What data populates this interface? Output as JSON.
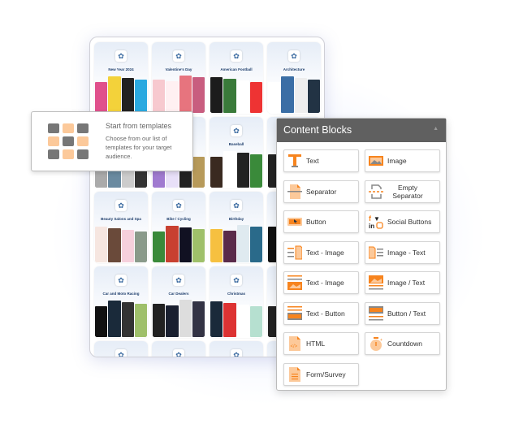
{
  "templates": [
    {
      "title": "New Year 2024"
    },
    {
      "title": "Valentine's Day"
    },
    {
      "title": "American Football"
    },
    {
      "title": "Architecture"
    },
    {
      "title": ""
    },
    {
      "title": ""
    },
    {
      "title": "Baseball"
    },
    {
      "title": ""
    },
    {
      "title": "Beauty Salons and Spa"
    },
    {
      "title": "Bike / Cycling"
    },
    {
      "title": "Birthday"
    },
    {
      "title": ""
    },
    {
      "title": "Car and Moto Racing"
    },
    {
      "title": "Car Dealers"
    },
    {
      "title": "Christmas"
    },
    {
      "title": ""
    },
    {
      "title": ""
    },
    {
      "title": ""
    },
    {
      "title": ""
    },
    {
      "title": ""
    }
  ],
  "tooltip": {
    "title": "Start from templates",
    "description": "Choose from our list of templates for your target audience."
  },
  "content_blocks": {
    "title": "Content Blocks",
    "accent": "#f7841e",
    "items": [
      {
        "label": "Text",
        "icon": "text-icon"
      },
      {
        "label": "Image",
        "icon": "image-icon"
      },
      {
        "label": "Separator",
        "icon": "separator-icon"
      },
      {
        "label": "Empty Separator",
        "icon": "empty-separator-icon"
      },
      {
        "label": "Button",
        "icon": "button-icon"
      },
      {
        "label": "Social Buttons",
        "icon": "social-icon"
      },
      {
        "label": "Text - Image",
        "icon": "text-image-icon"
      },
      {
        "label": "Image - Text",
        "icon": "image-text-icon"
      },
      {
        "label": "Text - Image",
        "icon": "text-over-image-icon"
      },
      {
        "label": "Image / Text",
        "icon": "image-over-text-icon"
      },
      {
        "label": "Text - Button",
        "icon": "text-button-icon"
      },
      {
        "label": "Button / Text",
        "icon": "button-text-icon"
      },
      {
        "label": "HTML",
        "icon": "html-icon"
      },
      {
        "label": "Countdown",
        "icon": "countdown-icon"
      },
      {
        "label": "Form/Survey",
        "icon": "form-icon"
      }
    ]
  }
}
